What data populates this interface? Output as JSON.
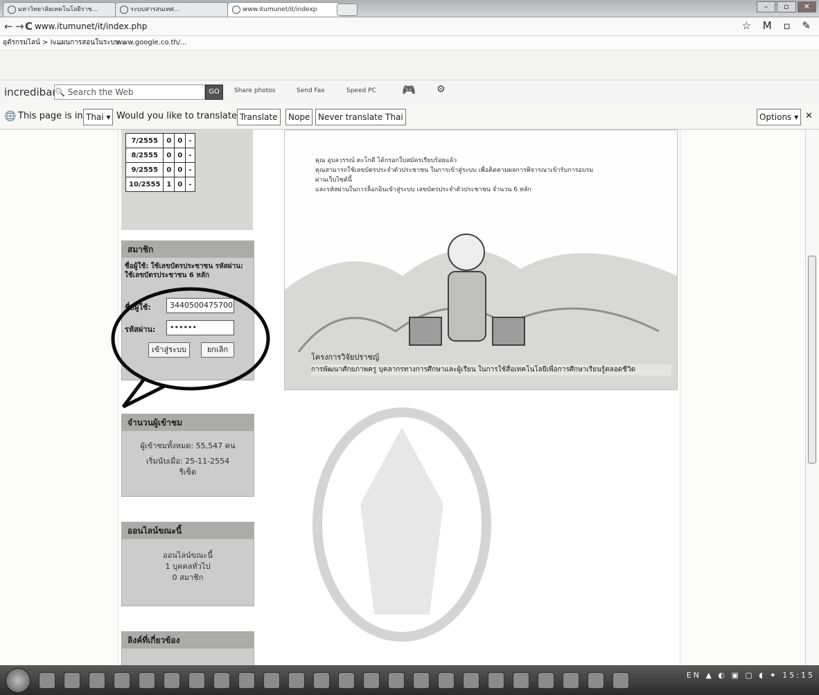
{
  "tabs": [
    {
      "label": "มหาวิทยาลัยเทคโนโลยีราช..."
    },
    {
      "label": "ระบบสารสนเทศ..."
    },
    {
      "label": "www.itumunet/it/indexp"
    }
  ],
  "window_buttons": {
    "minimize": "–",
    "maximize": "▫",
    "close": "✕"
  },
  "nav": {
    "back": "←",
    "forward": "→",
    "reload": "C",
    "url": "www.itumunet/it/index.php",
    "right_icons": "☆ M ▫ ✎"
  },
  "bookmarks": [
    {
      "label": "อุตัรกรมไลน์ > Iv..."
    },
    {
      "label": "แผนการสอนในระบบ..."
    },
    {
      "label": "www.google.co.th/..."
    }
  ],
  "incredibar": {
    "logo": "incredibar",
    "search_placeholder": "Search the Web",
    "go_label": "GO",
    "items": [
      "Share photos",
      "Send Fax",
      "Speed PC"
    ]
  },
  "translate_bar": {
    "page_in": "This page is in",
    "language": "Thai ▾",
    "question": "Would you like to translate it?",
    "translate_btn": "Translate",
    "nope_btn": "Nope",
    "never_btn": "Never translate Thai",
    "options_btn": "Options ▾",
    "close": "✕"
  },
  "stats_rows": [
    [
      "7/2555",
      "0",
      "0",
      "-"
    ],
    [
      "8/2555",
      "0",
      "0",
      "-"
    ],
    [
      "9/2555",
      "0",
      "0",
      "-"
    ],
    [
      "10/2555",
      "1",
      "0",
      "-"
    ]
  ],
  "member_panel": {
    "title": "สมาชิก",
    "notice": "ชื่อผู้ใช้: ใช้เลขบัตรประชาชน รหัสผ่าน: ใช้เลขบัตรประชาชน 6 หลัก",
    "username_label": "ชื่อผู้ใช้:",
    "username_value": "3440500475700",
    "password_label": "รหัสผ่าน:",
    "password_value": "••••••",
    "login_btn": "เข้าสู่ระบบ",
    "cancel_btn": "ยกเลิก"
  },
  "visitors_panel": {
    "title": "จำนวนผู้เข้าชม",
    "total": "ผู้เข้าชมทั้งหมด: 55,547 คน",
    "since": "เริ่มนับเมื่อ: 25-11-2554",
    "reset": "รีเซ็ต"
  },
  "online_panel": {
    "title": "ออนไลน์ขณะนี้",
    "line1": "ออนไลน์ขณะนี้",
    "line2": "1 บุคคลทั่วไป",
    "line3": "0 สมาชิก"
  },
  "links_panel": {
    "title": "ลิงค์ที่เกี่ยวข้อง"
  },
  "banner": {
    "lines": [
      "คุณ อุบลวรรณ์   ตะโกดี ได้กรอกใบสมัครเรียบร้อยแล้ว",
      "คุณสามารถใช้เลขบัตรประจำตัวประชาชน ในการเข้าสู่ระบบ เพื่อติดตามผลการพิจารณาเข้ารับการอบรม",
      "ผ่านเว็บไซต์นี้",
      "และรหัสผ่านในการล็อกอินเข้าสู่ระบบ เลขบัตรประจำตัวประชาชน จำนวน 6 หลัก"
    ],
    "footer_line1": "โครงการวิจัยปราชญ์",
    "footer_line2": "การพัฒนาศักยภาพครู บุคลากรทางการศึกษาและผู้เรียน ในการใช้สื่อเทคโนโลยีเพื่อการศึกษาเรียนรู้ตลอดชีวิต"
  },
  "taskbar": {
    "tray_text": "EN ▲ ◐ ▣ ▢ ◖ ✦  15:15"
  }
}
